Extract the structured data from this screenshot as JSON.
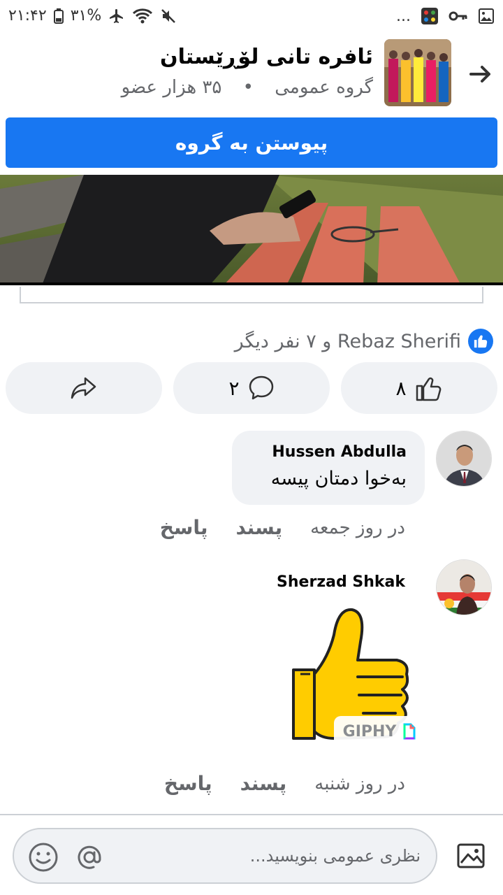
{
  "status_bar": {
    "time": "۲۱:۴۲",
    "battery": "۳۱%",
    "icons": [
      "battery-icon",
      "airplane-icon",
      "wifi-icon",
      "mute-icon",
      "more-icon",
      "app-icon",
      "key-icon",
      "image-icon"
    ],
    "more": "..."
  },
  "group": {
    "title": "ئافره تانی لۆڕێستان",
    "type": "گروه عمومی",
    "separator": "•",
    "members": "۳۵ هزار عضو"
  },
  "join_button": "پیوستن به گروه",
  "reactions": {
    "summary": "Rebaz Sherifi و ۷ نفر دیگر"
  },
  "actions": {
    "like_count": "۸",
    "comment_count": "۲"
  },
  "comments": [
    {
      "author": "Hussen Abdulla",
      "text": "بەخوا دمتان پیسه",
      "time": "در روز جمعه",
      "like": "پسند",
      "reply": "پاسخ"
    },
    {
      "author": "Sherzad Shkak",
      "gif_badge": "GIPHY",
      "time": "در روز شنبه",
      "like": "پسند",
      "reply": "پاسخ"
    }
  ],
  "composer": {
    "placeholder": "نظری عمومی بنویسید..."
  },
  "colors": {
    "accent": "#1877f2",
    "bubble": "#f0f2f5",
    "muted_text": "#65676b"
  }
}
